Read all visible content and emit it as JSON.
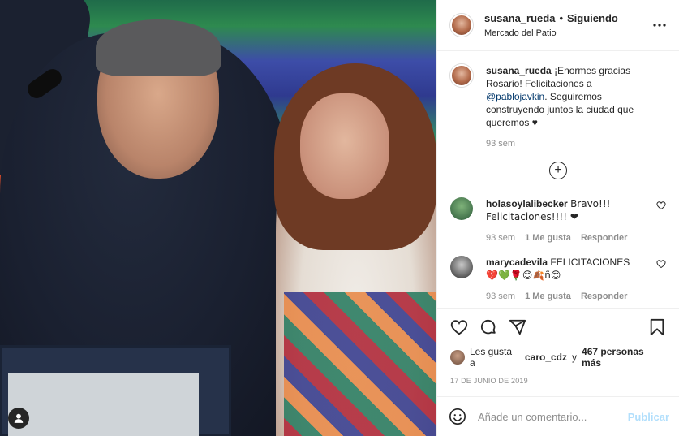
{
  "header": {
    "username": "susana_rueda",
    "separator": "•",
    "follow_status": "Siguiendo",
    "location": "Mercado del Patio"
  },
  "caption": {
    "username": "susana_rueda",
    "text_before": "¡Enormes gracias Rosario! Felicitaciones a ",
    "mention": "@pablojavkin",
    "text_after": ". Seguiremos construyendo juntos la ciudad que queremos ♥",
    "time": "93 sem"
  },
  "comments": [
    {
      "username": "holasoylalibecker",
      "text": "Bravo!!! Felicitaciones!!!! ❤",
      "time": "93 sem",
      "likes": "1 Me gusta",
      "reply": "Responder"
    },
    {
      "username": "marycadevila",
      "text": "FELICITACIONES",
      "emojis": "💔💚🌹😊🍂ñ😍",
      "time": "93 sem",
      "likes": "1 Me gusta",
      "reply": "Responder"
    }
  ],
  "load_more_label": "+",
  "likes": {
    "prefix": "Les gusta a",
    "user": "caro_cdz",
    "conjunction": "y",
    "others": "467 personas más"
  },
  "date": "17 DE JUNIO DE 2019",
  "add_comment": {
    "placeholder": "Añade un comentario...",
    "publish_label": "Publicar"
  },
  "icons": [
    "heart-icon",
    "comment-icon",
    "share-icon",
    "bookmark-icon",
    "more-icon",
    "smile-icon",
    "user-tag-icon"
  ]
}
